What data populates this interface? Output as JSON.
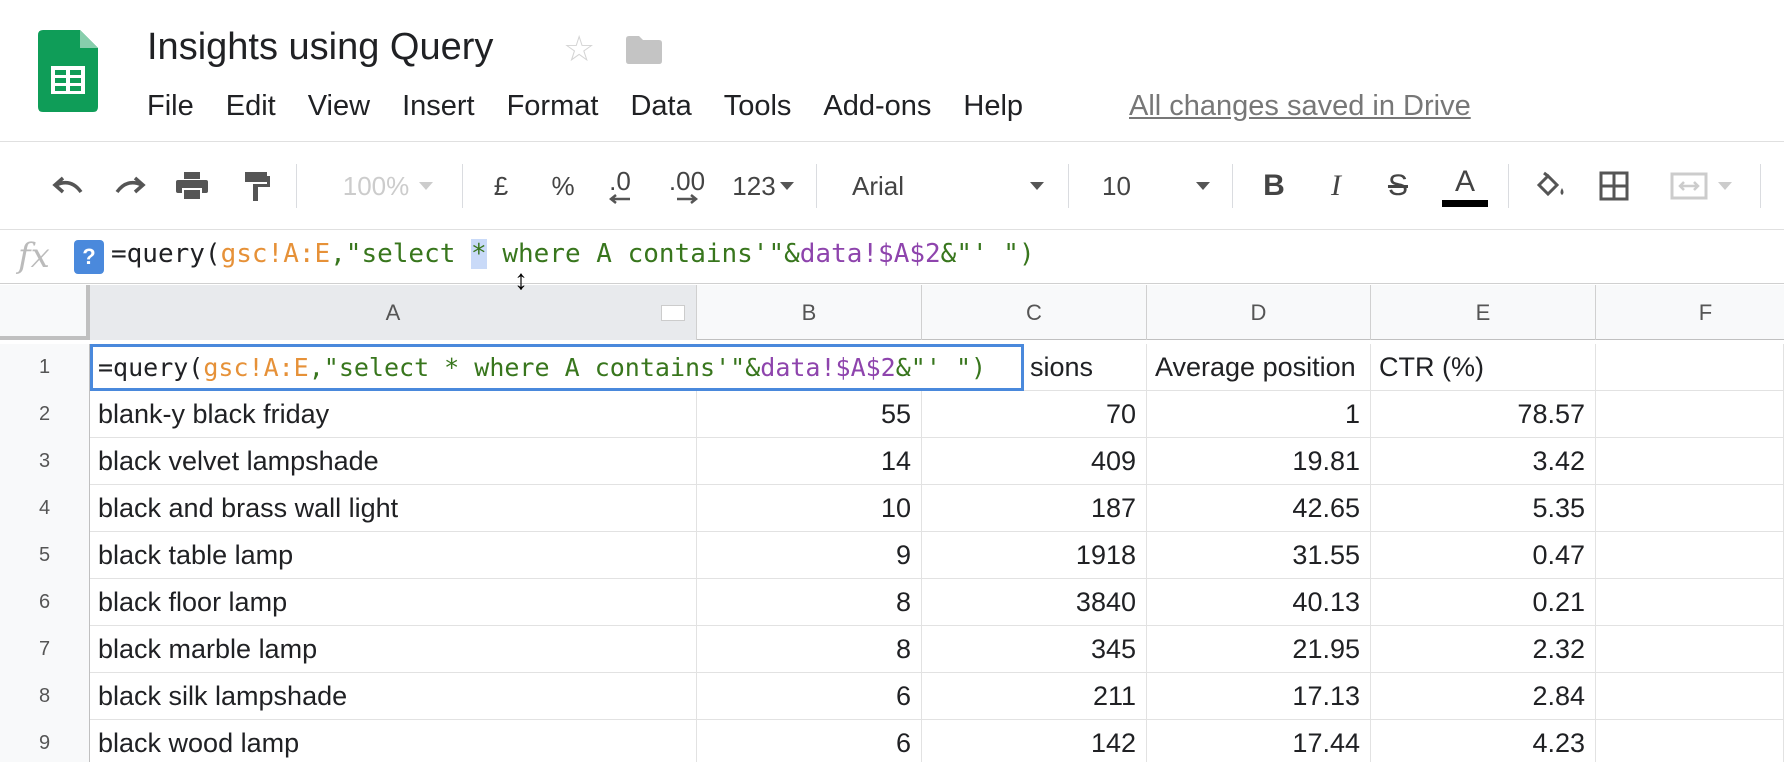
{
  "header": {
    "title": "Insights using Query",
    "star_icon": "star-icon",
    "folder_icon": "folder-icon",
    "menu": [
      "File",
      "Edit",
      "View",
      "Insert",
      "Format",
      "Data",
      "Tools",
      "Add-ons",
      "Help"
    ],
    "save_status": "All changes saved in Drive"
  },
  "toolbar": {
    "zoom": "100%",
    "currency": "£",
    "percent": "%",
    "dec_decrease": ".0",
    "dec_increase": ".00",
    "more_formats": "123",
    "font": "Arial",
    "font_size": "10",
    "bold": "B",
    "italic": "I",
    "strike": "S",
    "text_color": "A"
  },
  "formula_bar": {
    "fx": "fx",
    "help": "?",
    "parts": [
      "=query(",
      "gsc!A:E",
      ",\"select ",
      "*",
      " where A contains'\"&",
      "data!$A$2",
      "&\"' \")"
    ]
  },
  "grid": {
    "columns": [
      "A",
      "B",
      "C",
      "D",
      "E",
      "F"
    ],
    "row_numbers": [
      "1",
      "2",
      "3",
      "4",
      "5",
      "6",
      "7",
      "8",
      "9"
    ],
    "header_row": {
      "c_partial": "sions",
      "d": "Average position",
      "e": "CTR (%)"
    },
    "rows": [
      {
        "a": "blank-y black friday",
        "b": "55",
        "c": "70",
        "d": "1",
        "e": "78.57"
      },
      {
        "a": "black velvet lampshade",
        "b": "14",
        "c": "409",
        "d": "19.81",
        "e": "3.42"
      },
      {
        "a": "black and brass wall light",
        "b": "10",
        "c": "187",
        "d": "42.65",
        "e": "5.35"
      },
      {
        "a": "black table lamp",
        "b": "9",
        "c": "1918",
        "d": "31.55",
        "e": "0.47"
      },
      {
        "a": "black floor lamp",
        "b": "8",
        "c": "3840",
        "d": "40.13",
        "e": "0.21"
      },
      {
        "a": "black marble lamp",
        "b": "8",
        "c": "345",
        "d": "21.95",
        "e": "2.32"
      },
      {
        "a": "black silk lampshade",
        "b": "6",
        "c": "211",
        "d": "17.13",
        "e": "2.84"
      },
      {
        "a": "black wood lamp",
        "b": "6",
        "c": "142",
        "d": "17.44",
        "e": "4.23"
      }
    ],
    "editor_parts": [
      "=query(",
      "gsc!A:E",
      ",\"select * where A contains'\"&",
      "data!$A$2",
      "&\"' \")"
    ]
  },
  "colors": {
    "ref_orange": "#e69138",
    "string_green": "#38761d",
    "ref_purple": "#8e44ad",
    "selection_blue": "#4a89dc",
    "sheets_green": "#0f9d58"
  }
}
